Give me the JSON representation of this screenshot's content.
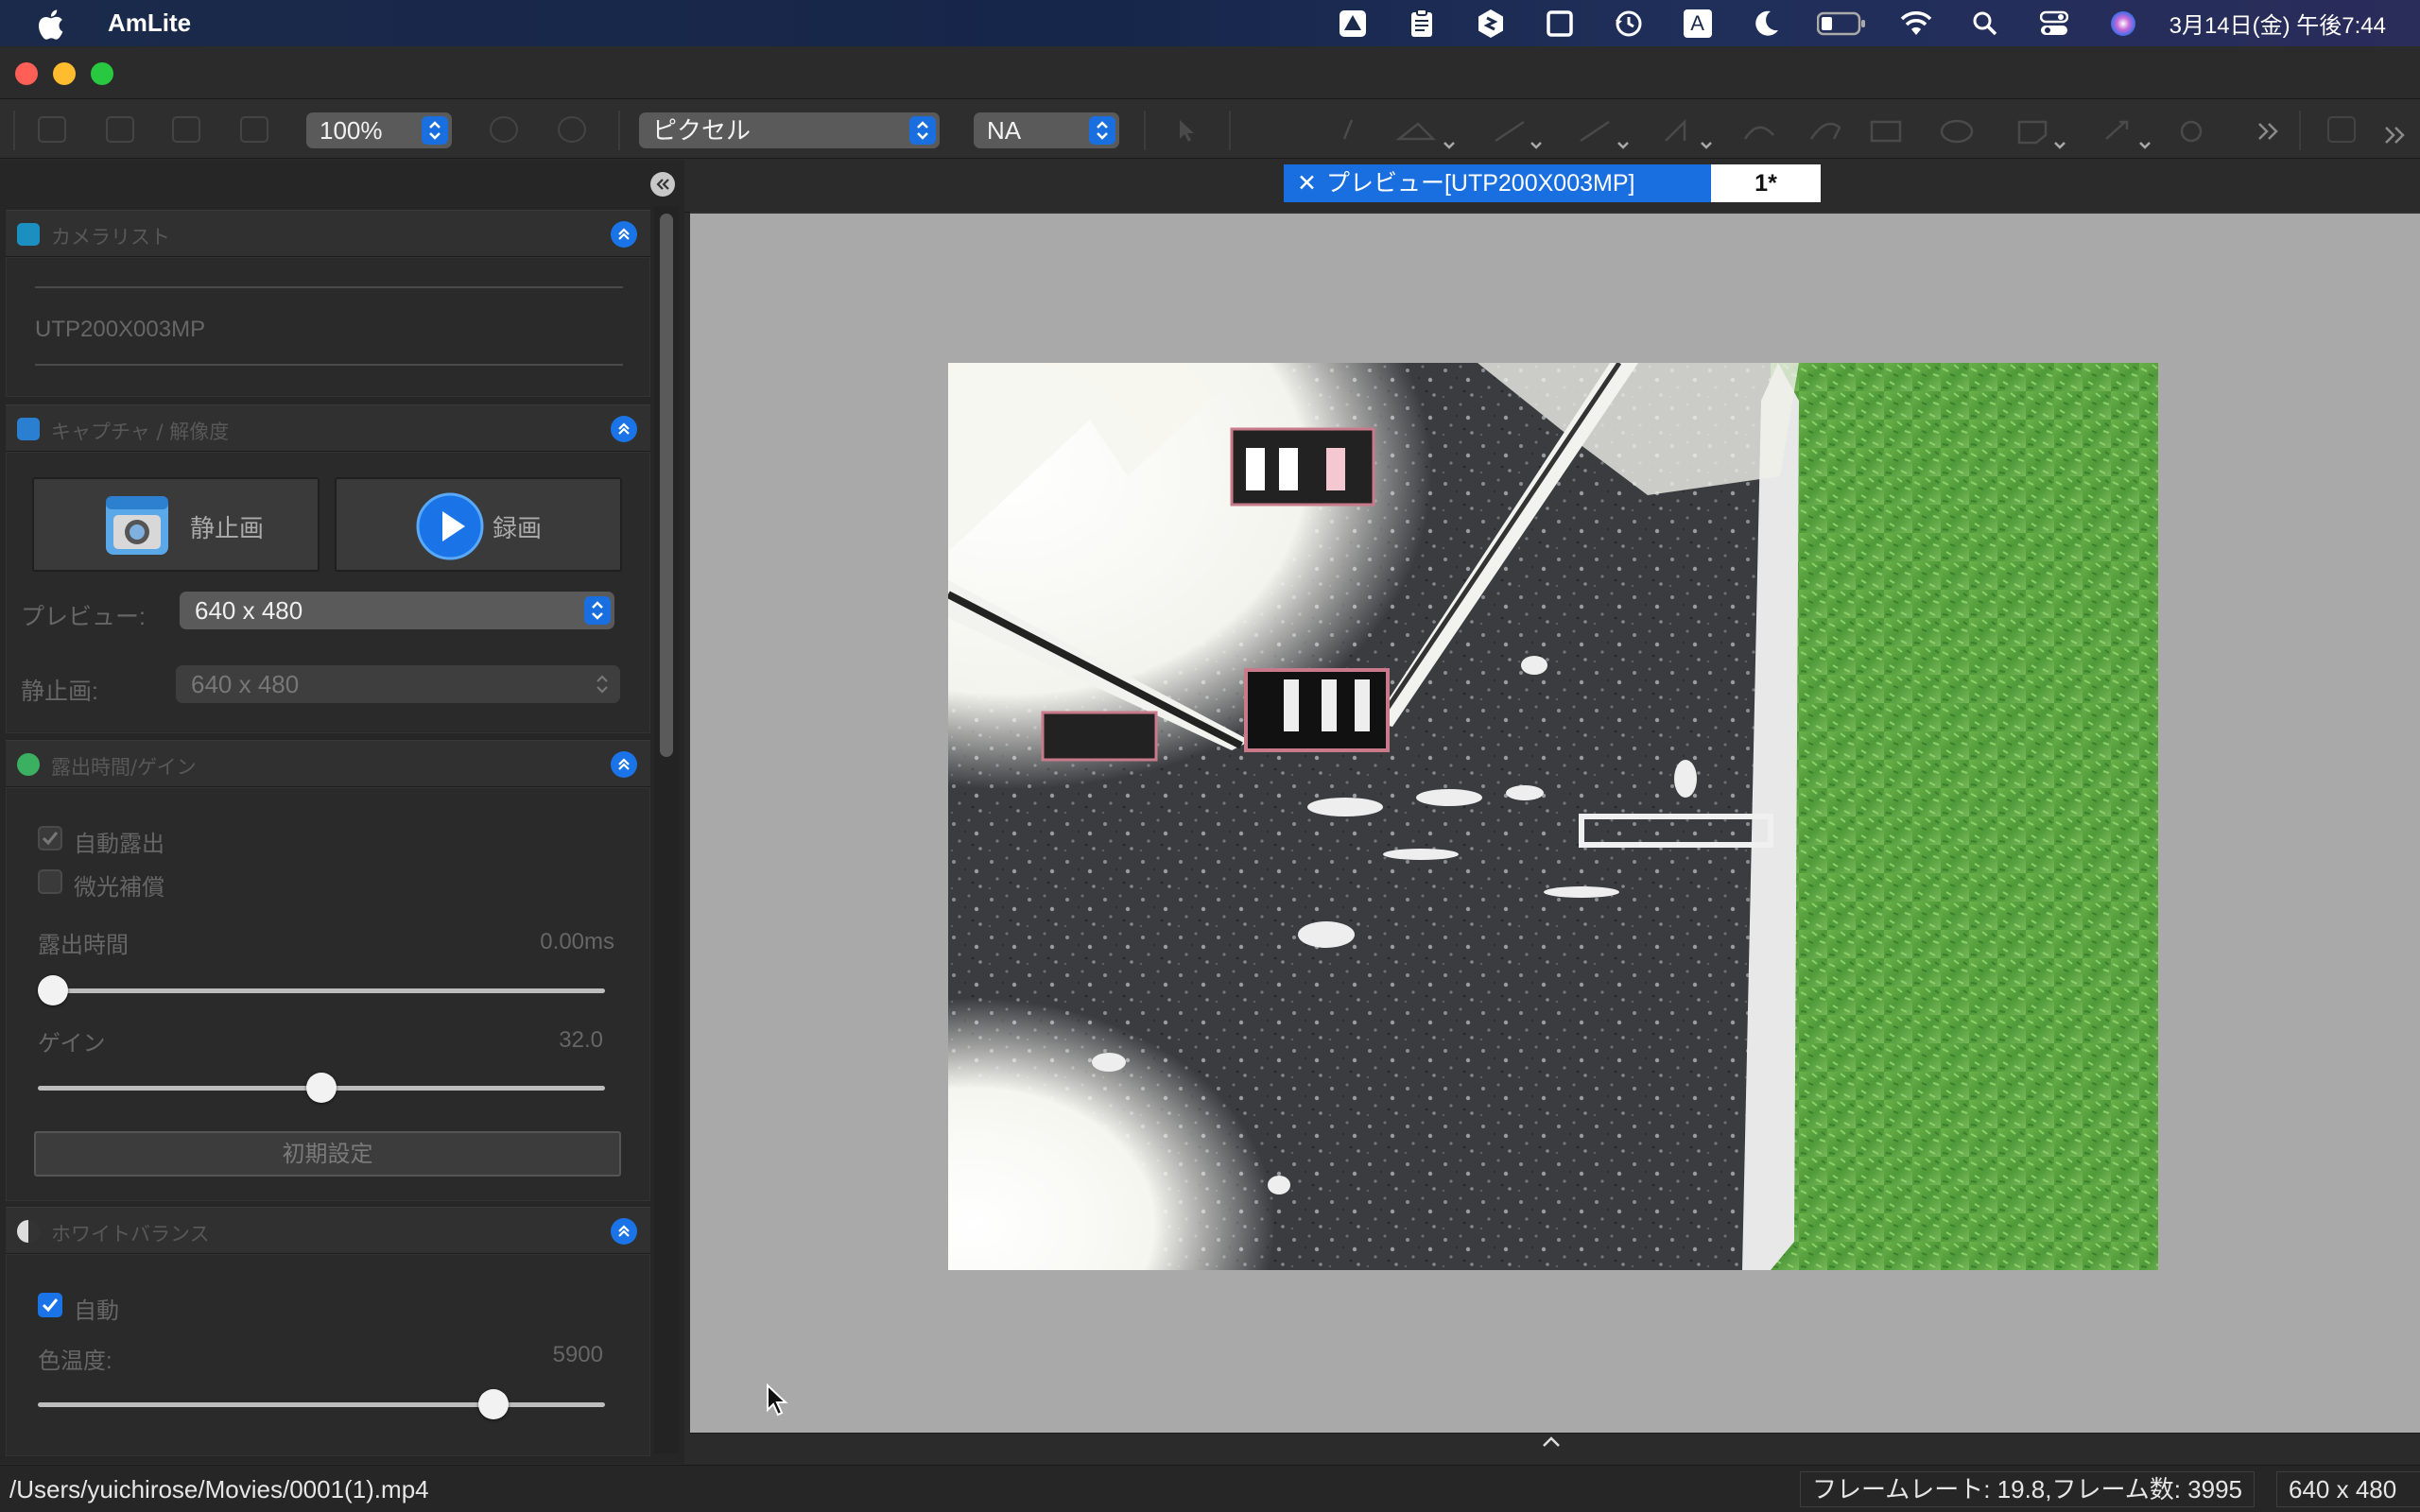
{
  "menubar": {
    "app_name": "AmLite",
    "clock": "3月14日(金) 午後7:44",
    "status_icons": [
      "drive-icon",
      "clipboard-icon",
      "shortcut-icon",
      "frame-icon",
      "time-machine-icon",
      "input-method-icon",
      "moon-icon",
      "battery-icon",
      "wifi-icon",
      "spotlight-icon",
      "control-center-icon",
      "siri-icon"
    ],
    "input_method_label": "A"
  },
  "toolbar": {
    "zoom": "100%",
    "unit": "ピクセル",
    "lens": "NA"
  },
  "panel": {
    "camera_list": {
      "title": "カメラリスト",
      "device": "UTP200X003MP"
    },
    "capture": {
      "title": "キャプチャ / 解像度",
      "still_label": "静止画",
      "record_label": "録画",
      "preview_label": "プレビュー:",
      "preview_value": "640 x 480",
      "still_res_label": "静止画:",
      "still_res_value": "640 x 480"
    },
    "exposure": {
      "title": "露出時間/ゲイン",
      "auto_exposure_label": "自動露出",
      "auto_exposure_checked": true,
      "low_light_label": "微光補償",
      "low_light_checked": false,
      "exposure_time_label": "露出時間",
      "exposure_time_value": "0.00ms",
      "exposure_slider_fraction": 0.0,
      "gain_label": "ゲイン",
      "gain_value": "32.0",
      "gain_slider_fraction": 0.5,
      "reset_label": "初期設定"
    },
    "white_balance": {
      "title": "ホワイトバランス",
      "auto_label": "自動",
      "auto_checked": true,
      "temp_label": "色温度:",
      "temp_value": "5900",
      "temp_slider_fraction": 0.82
    }
  },
  "tabs": [
    {
      "label": "プレビュー[UTP200X003MP]",
      "active": true
    },
    {
      "label": "1*",
      "active": false
    }
  ],
  "statusbar": {
    "path": "/Users/yuichirose/Movies/0001(1).mp4",
    "frame_info": "フレームレート: 19.8,フレーム数: 3995",
    "resolution": "640 x 480"
  },
  "colors": {
    "accent": "#1a6fe0",
    "preview_bg": "#a9a9a9"
  }
}
